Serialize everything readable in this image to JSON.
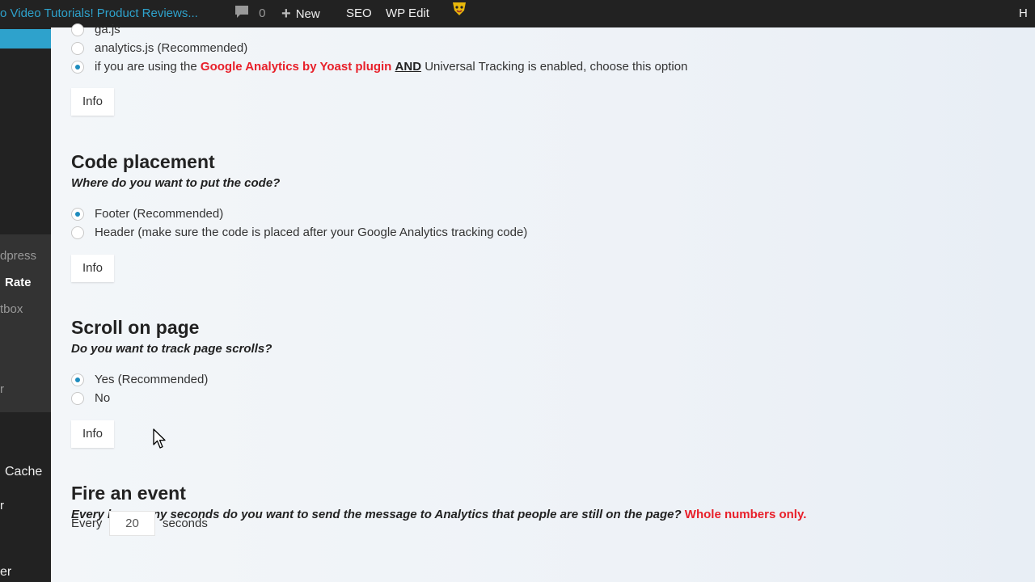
{
  "adminbar": {
    "site_name": "o Video Tutorials! Product Reviews...",
    "comments_count": "0",
    "new_label": "New",
    "seo_label": "SEO",
    "wpedit_label": "WP Edit",
    "howdy": "H"
  },
  "sidebar": {
    "items": [
      "dpress",
      "Rate",
      "tbox",
      "r",
      "Cache",
      "r",
      "er"
    ]
  },
  "tracking_options": {
    "ga_js": "ga.js",
    "analytics_js": "analytics.js (Recommended)",
    "yoast_prefix": "if you are using the",
    "yoast_plugin": "Google Analytics by Yoast plugin",
    "yoast_and": "AND",
    "yoast_suffix": "Universal Tracking is enabled, choose this option",
    "info": "Info"
  },
  "code_placement": {
    "title": "Code placement",
    "question": "Where do you want to put the code?",
    "option_footer": "Footer (Recommended)",
    "option_header": "Header (make sure the code is placed after your Google Analytics tracking code)",
    "info": "Info"
  },
  "scroll_on_page": {
    "title": "Scroll on page",
    "question": "Do you want to track page scrolls?",
    "option_yes": "Yes (Recommended)",
    "option_no": "No",
    "info": "Info"
  },
  "fire_event": {
    "title": "Fire an event",
    "question": "Every how many seconds do you want to send the message to Analytics that people are still on the page?",
    "note": "Whole numbers only.",
    "every_label": "Every",
    "seconds_value": "20",
    "seconds_label": "seconds"
  },
  "colors": {
    "accent": "#2ea2cc",
    "warning_red": "#e8202a",
    "adminbar_bg": "#222222"
  }
}
